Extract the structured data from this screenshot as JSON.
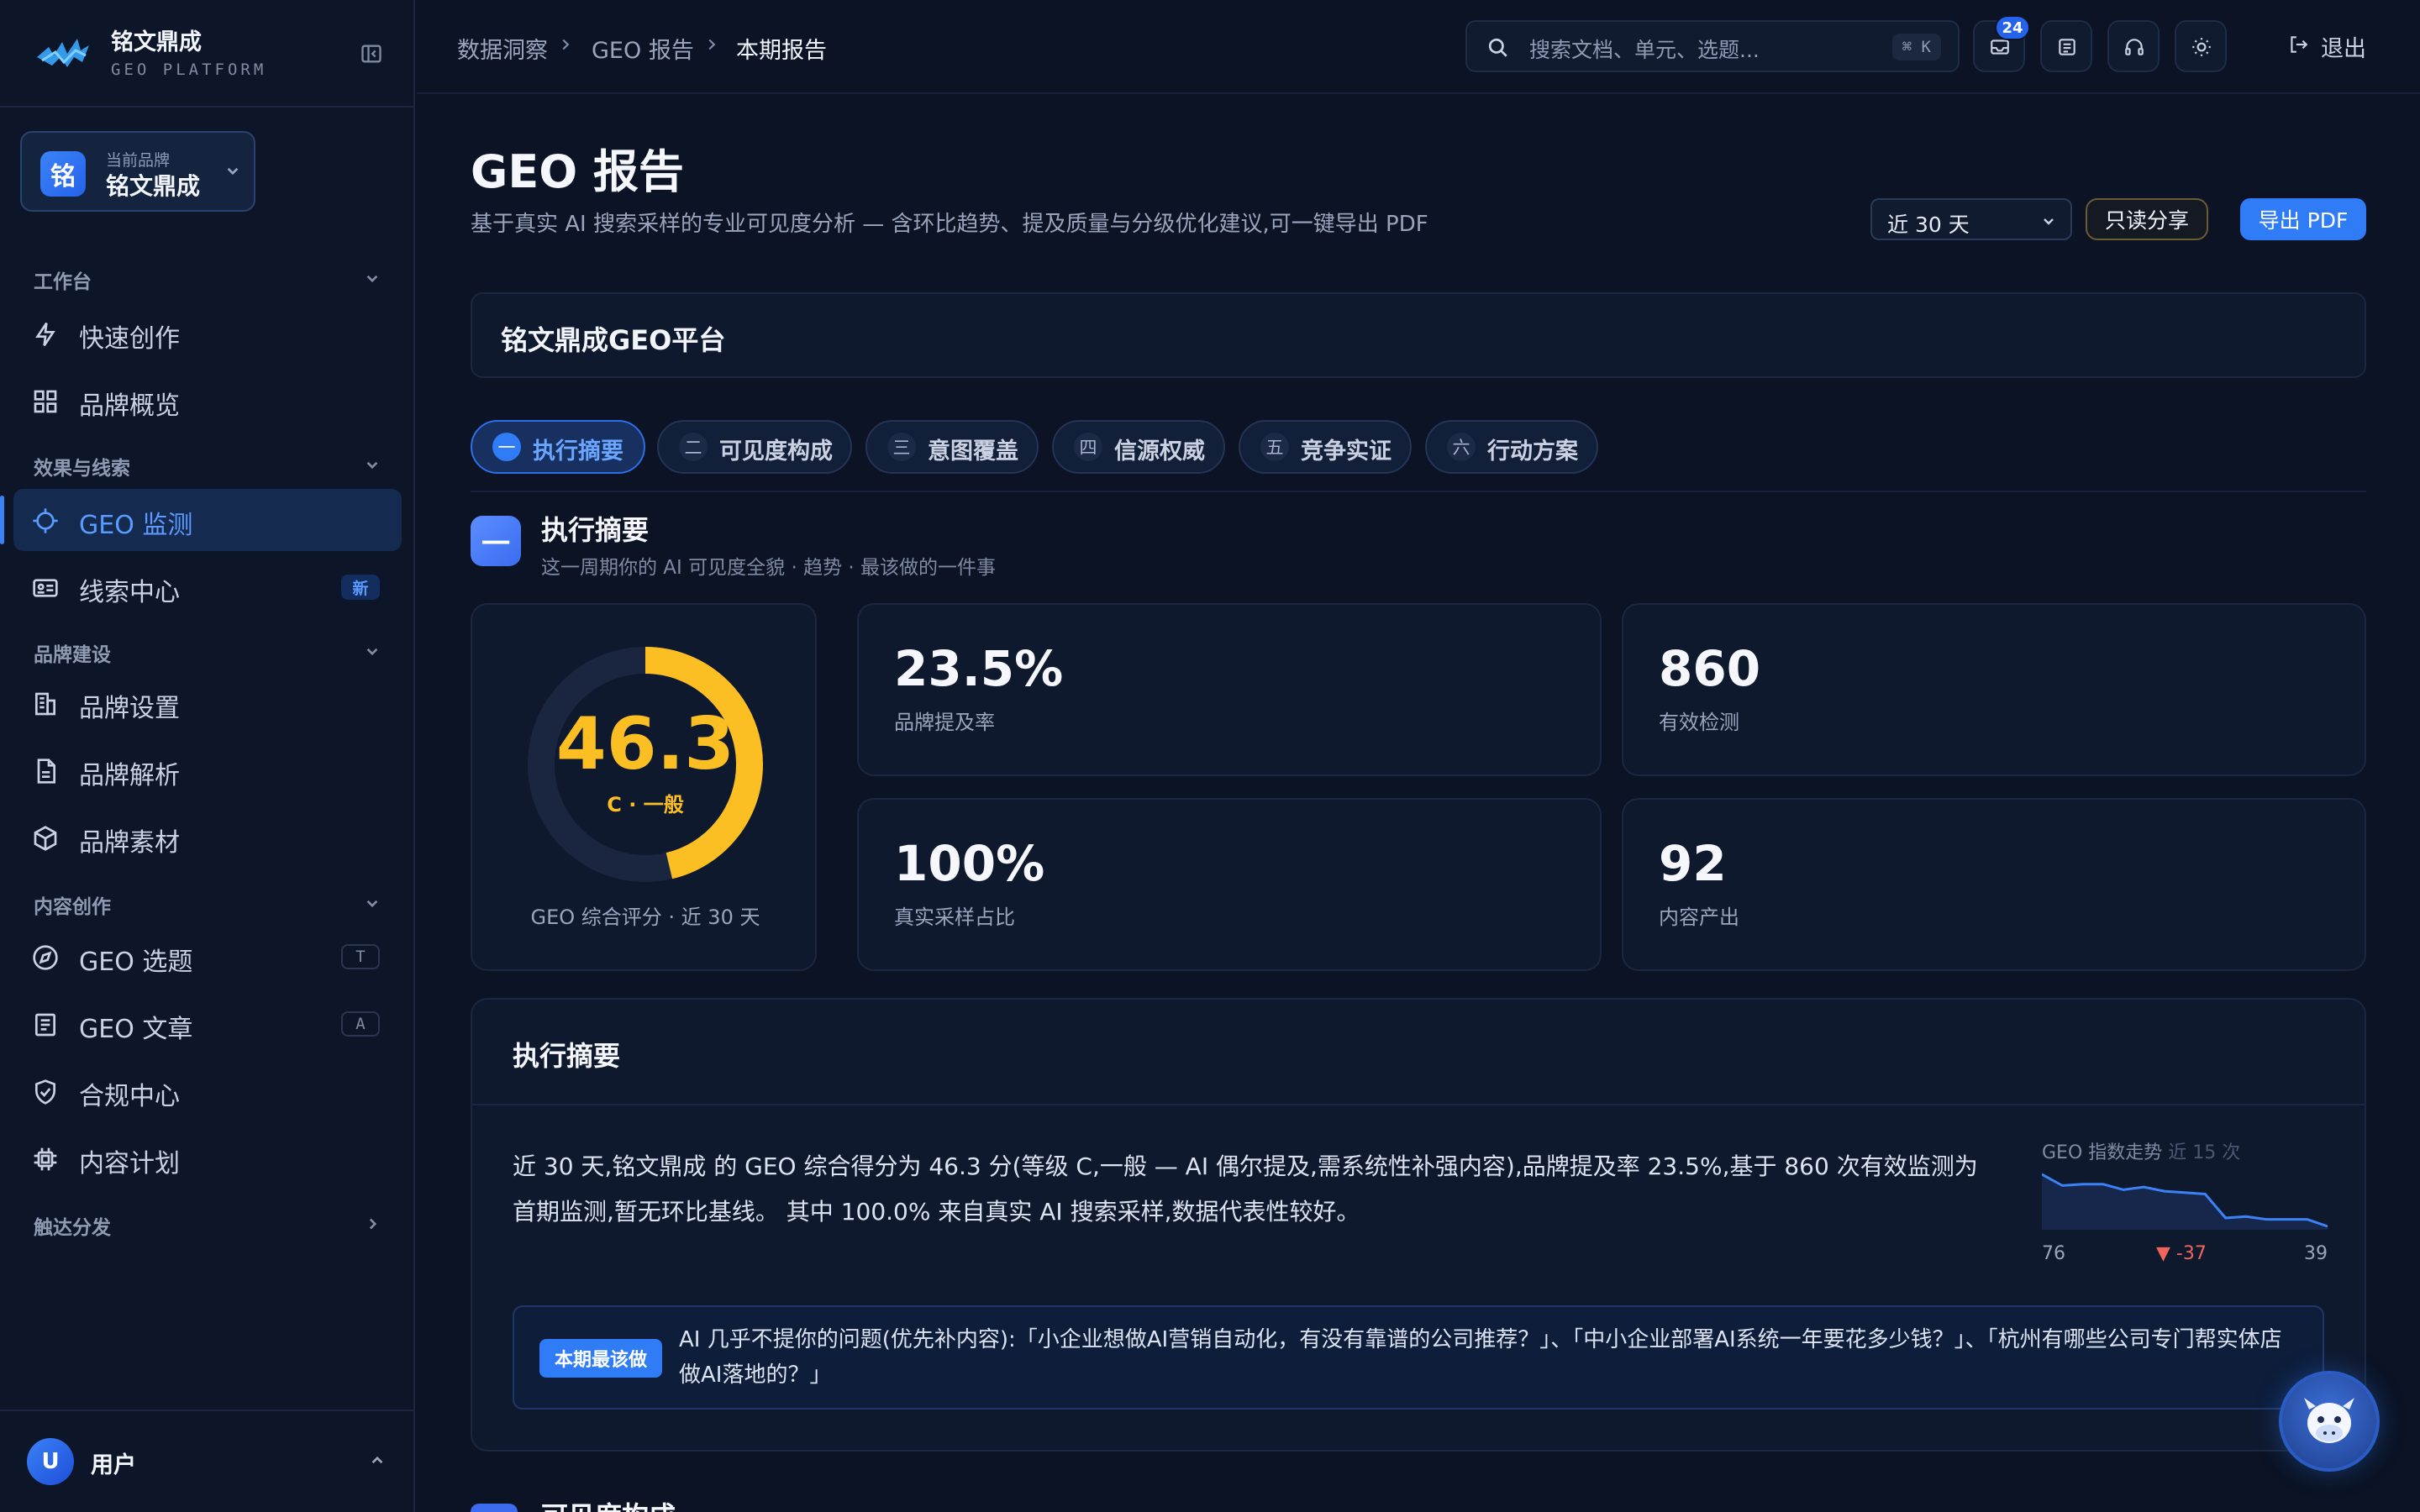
{
  "app": {
    "name": "铭文鼎成",
    "platform": "GEO PLATFORM"
  },
  "brand_selector": {
    "label": "当前品牌",
    "value": "铭文鼎成",
    "avatar": "铭"
  },
  "sidebar": {
    "sections": [
      {
        "title": "工作台",
        "items": [
          {
            "label": "快速创作",
            "icon": "bolt-icon"
          },
          {
            "label": "品牌概览",
            "icon": "grid-icon"
          }
        ]
      },
      {
        "title": "效果与线索",
        "items": [
          {
            "label": "GEO 监测",
            "icon": "crosshair-icon",
            "active": true
          },
          {
            "label": "线索中心",
            "icon": "id-card-icon",
            "badge": "新"
          }
        ]
      },
      {
        "title": "品牌建设",
        "items": [
          {
            "label": "品牌设置",
            "icon": "building-icon"
          },
          {
            "label": "品牌解析",
            "icon": "document-icon"
          },
          {
            "label": "品牌素材",
            "icon": "cube-icon"
          }
        ]
      },
      {
        "title": "内容创作",
        "items": [
          {
            "label": "GEO 选题",
            "icon": "compass-icon",
            "shortcut": "T"
          },
          {
            "label": "GEO 文章",
            "icon": "article-icon",
            "shortcut": "A"
          },
          {
            "label": "合规中心",
            "icon": "shield-check-icon"
          },
          {
            "label": "内容计划",
            "icon": "chip-icon"
          }
        ]
      },
      {
        "title": "触达分发",
        "items": []
      }
    ]
  },
  "user": {
    "avatar": "U",
    "name": "用户"
  },
  "topbar": {
    "breadcrumb": [
      "数据洞察",
      "GEO 报告",
      "本期报告"
    ],
    "search_placeholder": "搜索文档、单元、选题...",
    "search_shortcut": "⌘ K",
    "notification_count": "24",
    "logout": "退出"
  },
  "page": {
    "title": "GEO 报告",
    "subtitle": "基于真实 AI 搜索采样的专业可见度分析 — 含环比趋势、提及质量与分级优化建议,可一键导出 PDF",
    "range": "近 30 天",
    "share": "只读分享",
    "export": "导出 PDF",
    "brand_bar": "铭文鼎成GEO平台"
  },
  "tabs": [
    {
      "num": "一",
      "label": "执行摘要",
      "active": true
    },
    {
      "num": "二",
      "label": "可见度构成"
    },
    {
      "num": "三",
      "label": "意图覆盖"
    },
    {
      "num": "四",
      "label": "信源权威"
    },
    {
      "num": "五",
      "label": "竞争实证"
    },
    {
      "num": "六",
      "label": "行动方案"
    }
  ],
  "section": {
    "badge": "一",
    "title": "执行摘要",
    "subtitle": "这一周期你的 AI 可见度全貌 · 趋势 · 最该做的一件事"
  },
  "score": {
    "value": "46.3",
    "max": 100,
    "grade": "C · 一般",
    "caption": "GEO 综合评分 · 近 30 天",
    "color": "#fbbf24"
  },
  "stats": [
    {
      "value": "23.5%",
      "label": "品牌提及率"
    },
    {
      "value": "860",
      "label": "有效检测"
    },
    {
      "value": "100%",
      "label": "真实采样占比"
    },
    {
      "value": "92",
      "label": "内容产出"
    }
  ],
  "summary": {
    "title": "执行摘要",
    "text": "近 30 天,铭文鼎成 的 GEO 综合得分为 46.3 分(等级 C,一般 — AI 偶尔提及,需系统性补强内容),品牌提及率 23.5%,基于 860 次有效监测为首期监测,暂无环比基线。 其中 100.0% 来自真实 AI 搜索采样,数据代表性较好。",
    "trend": {
      "title": "GEO 指数走势",
      "period": "近 15 次",
      "start": "76",
      "delta": "▼ -37",
      "end": "39",
      "values": [
        76,
        68,
        69,
        69,
        65,
        67,
        64,
        63,
        62,
        45,
        46,
        44,
        44,
        44,
        39
      ]
    },
    "todo_tag": "本期最该做",
    "todo_text": "AI 几乎不提你的问题(优先补内容):「小企业想做AI营销自动化，有没有靠谱的公司推荐？」、「中小企业部署AI系统一年要花多少钱？」、「杭州有哪些公司专门帮实体店做AI落地的？」"
  },
  "next_section": {
    "title": "可见度构成"
  }
}
